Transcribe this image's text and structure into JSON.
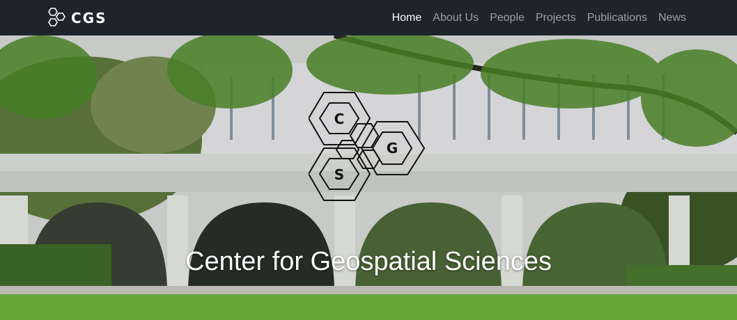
{
  "nav": {
    "brand_text": "CGS",
    "links": [
      {
        "label": "Home",
        "active": true
      },
      {
        "label": "About Us",
        "active": false
      },
      {
        "label": "People",
        "active": false
      },
      {
        "label": "Projects",
        "active": false
      },
      {
        "label": "Publications",
        "active": false
      },
      {
        "label": "News",
        "active": false
      }
    ]
  },
  "hero": {
    "title": "Center for Geospatial Sciences",
    "logo_letters": [
      "C",
      "G",
      "S"
    ]
  },
  "colors": {
    "navbar_bg": "#1e242c",
    "nav_active": "#ffffff",
    "nav_inactive": "#9aa0a6",
    "title": "#ffffff"
  }
}
